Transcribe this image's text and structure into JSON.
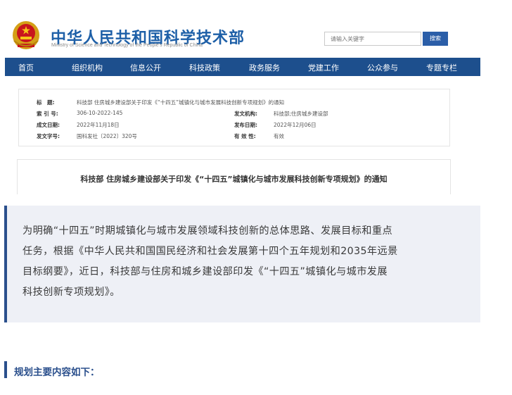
{
  "header": {
    "logo_cn": "中华人民共和国科学技术部",
    "logo_en": "Ministry of Science and Technology of the People's Republic of China",
    "search_placeholder": "请输入关键字",
    "search_button": "搜索"
  },
  "nav": {
    "items": [
      "首页",
      "组织机构",
      "信息公开",
      "科技政策",
      "政务服务",
      "党建工作",
      "公众参与",
      "专题专栏"
    ]
  },
  "info": {
    "title_label": "标　题:",
    "title_value": "科技部 住房城乡建设部关于印发《“十四五”城镇化与城市发展科技创新专项规划》的通知",
    "index_label": "索 引 号:",
    "index_value": "306-10-2022-145",
    "issuer_label": "发文机构:",
    "issuer_value": "科技部;住房城乡建设部",
    "created_label": "成文日期:",
    "created_value": "2022年11月18日",
    "published_label": "发布日期:",
    "published_value": "2022年12月06日",
    "docno_label": "发文字号:",
    "docno_value": "国科发社〔2022〕320号",
    "validity_label": "有 效 性:",
    "validity_value": "有效"
  },
  "article": {
    "title": "科技部 住房城乡建设部关于印发《“十四五”城镇化与城市发展科技创新专项规划》的通知"
  },
  "quote": {
    "lines": [
      "为明确“十四五”时期城镇化与城市发展领域科技创新的总体思路、发展目标和重点",
      "任务，根据《中华人民共和国国民经济和社会发展第十四个五年规划和2035年远景",
      "目标纲要》，近日，科技部与住房和城乡建设部印发《“十四五”城镇化与城市发展",
      "科技创新专项规划》。"
    ]
  },
  "section": {
    "heading": "规划主要内容如下："
  },
  "colors": {
    "nav_bg": "#1d4f8d",
    "logo_blue": "#1d5fa7",
    "accent": "#2a4f8c",
    "quote_bg": "#eef0f6"
  }
}
